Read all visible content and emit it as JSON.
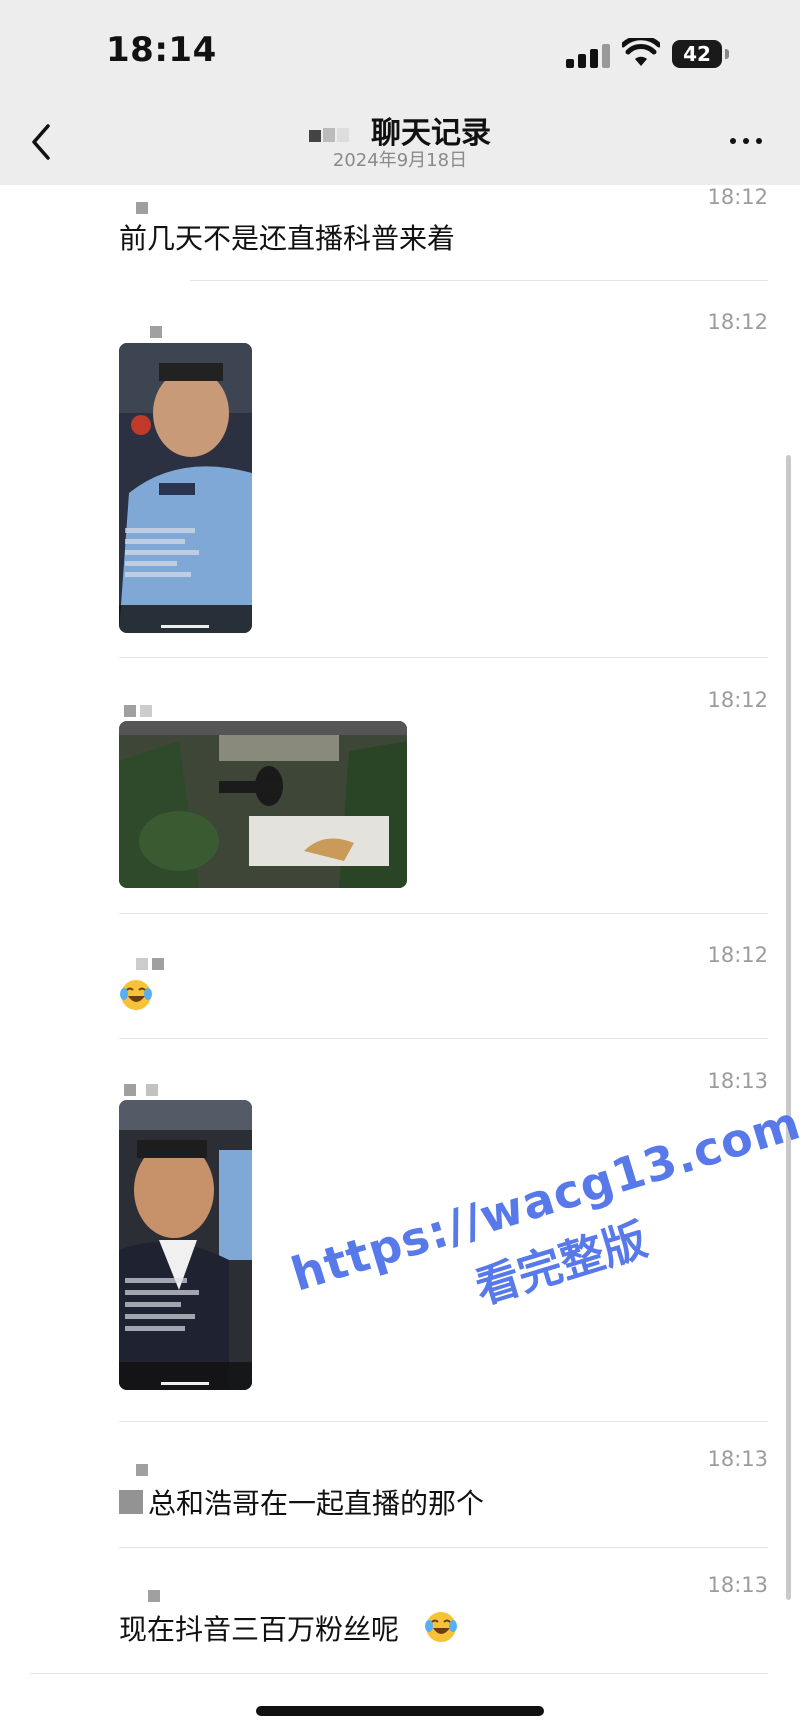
{
  "status_bar": {
    "time": "18:14",
    "battery": "42"
  },
  "nav": {
    "title": "聊天记录",
    "subtitle": "2024年9月18日"
  },
  "messages": [
    {
      "time": "18:12",
      "text": "前几天不是还直播科普来着"
    },
    {
      "time": "18:12"
    },
    {
      "time": "18:12"
    },
    {
      "time": "18:12",
      "emoji": "laughing-crying-emoji"
    },
    {
      "time": "18:13"
    },
    {
      "time": "18:13",
      "text": "总和浩哥在一起直播的那个"
    },
    {
      "time": "18:13",
      "text": "现在抖音三百万粉丝呢"
    }
  ],
  "watermark": {
    "line1": "https://wacg13.com",
    "line2": "看完整版"
  },
  "colors": {
    "bar_bg": "#ededed",
    "time_gray": "#9c9c9c",
    "watermark_blue": "#4a6ee8"
  }
}
